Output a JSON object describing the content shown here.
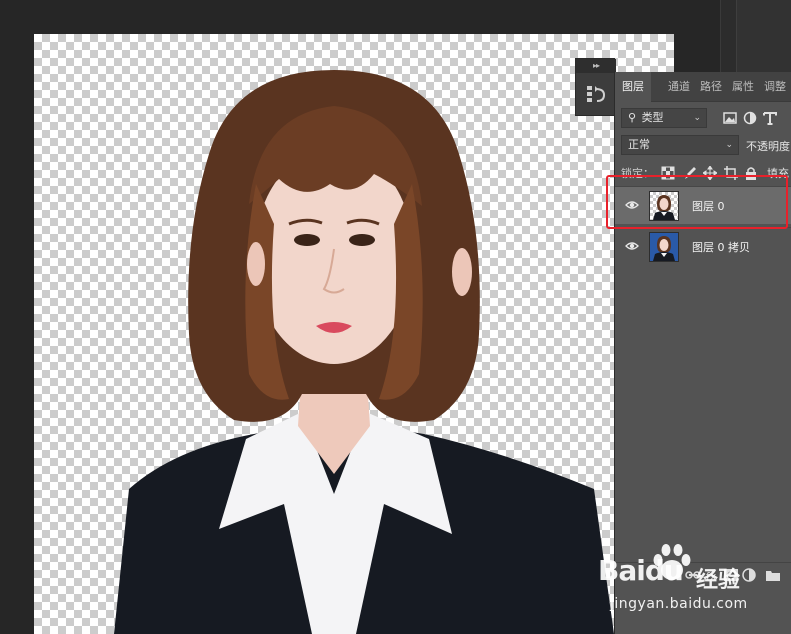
{
  "panel": {
    "tabs": [
      {
        "label": "图层",
        "active": true
      },
      {
        "label": "通道",
        "active": false
      },
      {
        "label": "路径",
        "active": false
      },
      {
        "label": "属性",
        "active": false
      },
      {
        "label": "调整",
        "active": false
      }
    ],
    "filter": {
      "kind_label": "类型"
    },
    "blend": {
      "mode_label": "正常",
      "opacity_label": "不透明度"
    },
    "lock": {
      "label": "锁定：",
      "fill_label": "填充"
    },
    "layers": [
      {
        "name": "图层 0",
        "selected": true,
        "visible": true,
        "transparent_bg": true
      },
      {
        "name": "图层 0 拷贝",
        "selected": false,
        "visible": true,
        "transparent_bg": false
      }
    ],
    "highlight_color": "#e8212b"
  },
  "icons": {
    "collapsed_panel": "history-icon",
    "filter_icons": [
      "image-filter-icon",
      "adjustment-filter-icon",
      "type-filter-icon"
    ],
    "lock_icons": [
      "lock-transparent-icon",
      "lock-brush-icon",
      "lock-move-icon",
      "lock-artboard-icon",
      "lock-all-icon"
    ],
    "bottom_icons": [
      "link-icon",
      "fx-icon",
      "mask-icon",
      "adjustment-layer-icon",
      "folder-icon",
      "new-layer-icon",
      "trash-icon"
    ]
  },
  "watermark": {
    "brand": "Baidu",
    "product": "经验",
    "url": "jingyan.baidu.com"
  }
}
